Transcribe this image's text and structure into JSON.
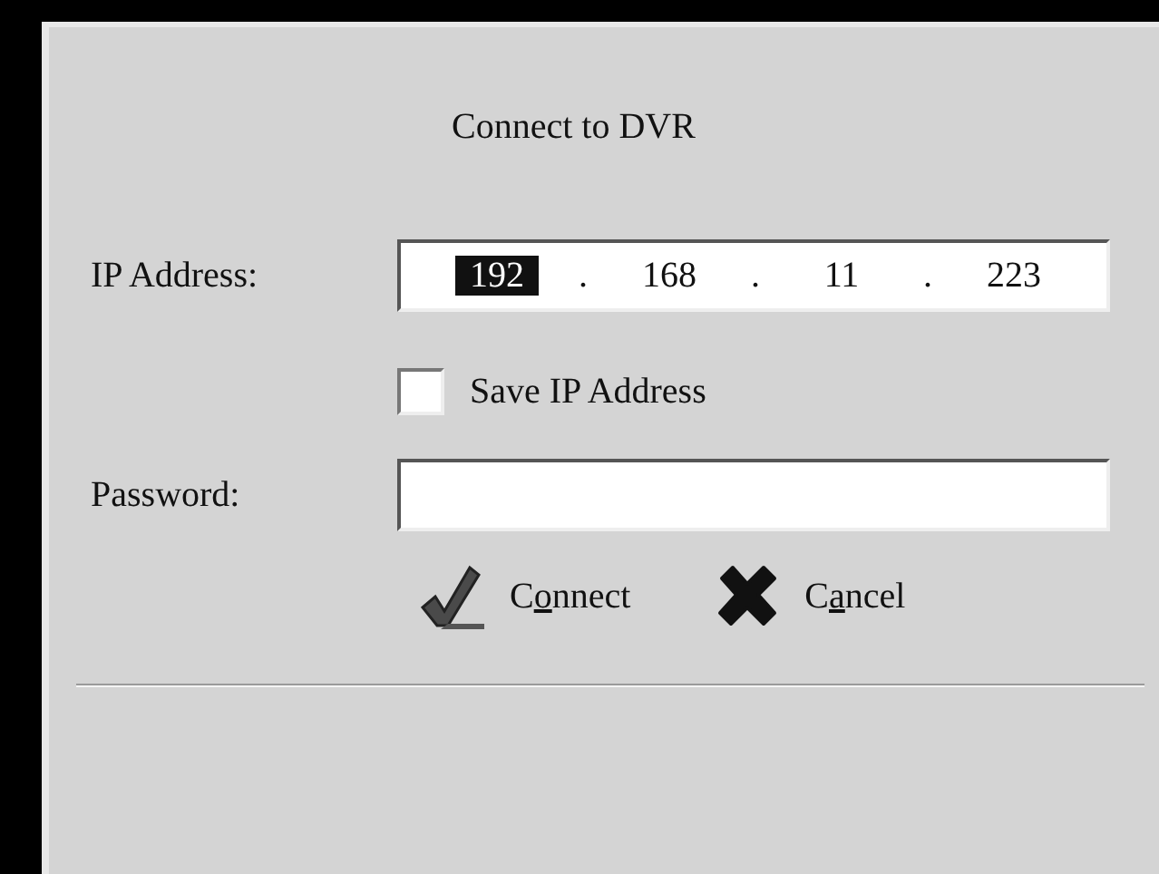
{
  "dialog": {
    "title": "Connect to DVR"
  },
  "ip_address": {
    "label": "IP Address:",
    "octets": [
      {
        "value": "192",
        "selected": true
      },
      {
        "value": "168",
        "selected": false
      },
      {
        "value": "11",
        "selected": false
      },
      {
        "value": "223",
        "selected": false
      }
    ],
    "separator": "."
  },
  "save_ip": {
    "label": "Save IP Address",
    "checked": false
  },
  "password": {
    "label": "Password:"
  },
  "buttons": [
    {
      "kind": "confirm",
      "label_start": "C",
      "mnemonic": "o",
      "label_end": "nnect"
    },
    {
      "kind": "cancel",
      "label_start": "C",
      "mnemonic": "a",
      "label_end": "ncel"
    }
  ]
}
